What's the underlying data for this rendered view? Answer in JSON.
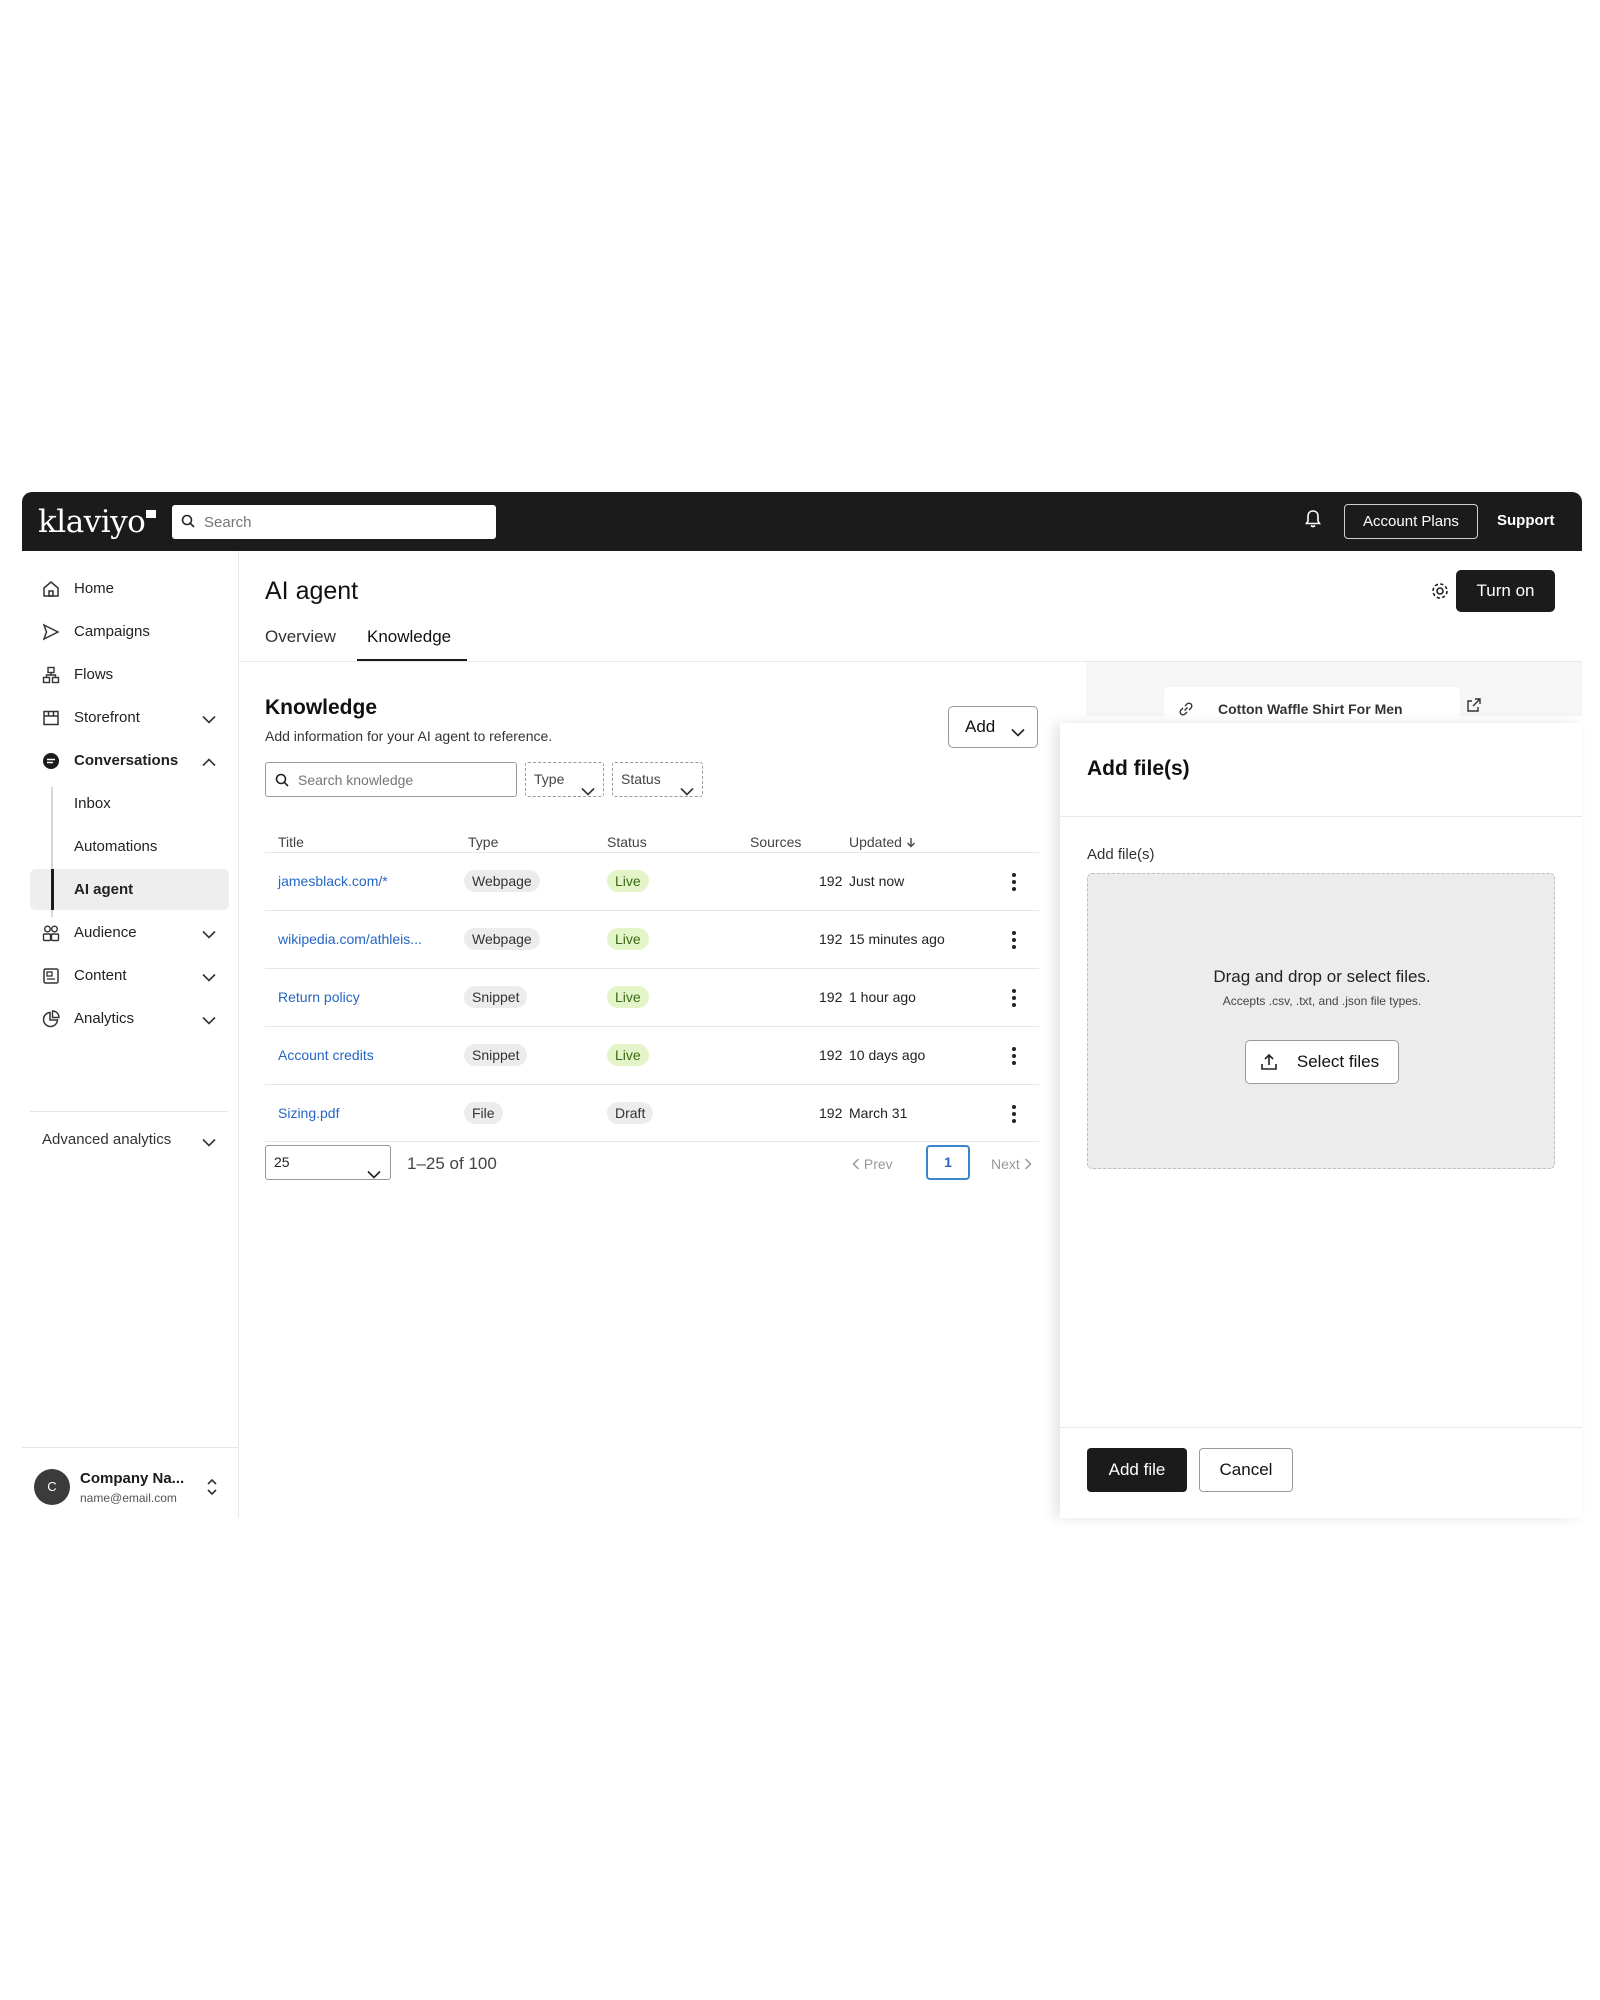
{
  "brand": {
    "logo_text": "klaviyo"
  },
  "topbar": {
    "search_placeholder": "Search",
    "account_plans_label": "Account Plans",
    "support_label": "Support"
  },
  "sidebar": {
    "items": [
      {
        "label": "Home",
        "icon": "home-icon"
      },
      {
        "label": "Campaigns",
        "icon": "send-icon"
      },
      {
        "label": "Flows",
        "icon": "flows-icon"
      },
      {
        "label": "Storefront",
        "icon": "storefront-icon"
      },
      {
        "label": "Conversations",
        "icon": "chat-icon"
      },
      {
        "label": "Audience",
        "icon": "audience-icon"
      },
      {
        "label": "Content",
        "icon": "content-icon"
      },
      {
        "label": "Analytics",
        "icon": "analytics-icon"
      }
    ],
    "sub_items": [
      "Inbox",
      "Automations",
      "AI agent"
    ],
    "advanced_label": "Advanced analytics",
    "account": {
      "initial": "C",
      "name": "Company Na...",
      "email": "name@email.com"
    }
  },
  "main": {
    "title": "AI agent",
    "turn_on_label": "Turn on",
    "tabs": [
      {
        "label": "Overview",
        "active": false
      },
      {
        "label": "Knowledge",
        "active": true
      }
    ],
    "knowledge": {
      "title": "Knowledge",
      "subtitle": "Add information for your AI agent to reference.",
      "add_label": "Add",
      "search_placeholder": "Search knowledge",
      "filters": [
        "Type",
        "Status"
      ],
      "columns": [
        "Title",
        "Type",
        "Status",
        "Sources",
        "Updated"
      ],
      "rows": [
        {
          "title": "jamesblack.com/*",
          "type": "Webpage",
          "status": "Live",
          "sources": "192",
          "updated": "Just now"
        },
        {
          "title": "wikipedia.com/athleis...",
          "type": "Webpage",
          "status": "Live",
          "sources": "192",
          "updated": "15 minutes ago"
        },
        {
          "title": "Return policy",
          "type": "Snippet",
          "status": "Live",
          "sources": "192",
          "updated": "1 hour ago"
        },
        {
          "title": "Account credits",
          "type": "Snippet",
          "status": "Live",
          "sources": "192",
          "updated": "10 days ago"
        },
        {
          "title": "Sizing.pdf",
          "type": "File",
          "status": "Draft",
          "sources": "192",
          "updated": "March 31"
        }
      ],
      "pagination": {
        "per_page": "25",
        "range": "1–25 of 100",
        "prev": "Prev",
        "page": "1",
        "next": "Next"
      }
    },
    "preview": {
      "product_title": "Cotton Waffle Shirt For Men"
    }
  },
  "drawer": {
    "title": "Add file(s)",
    "field_label": "Add file(s)",
    "dropzone_main": "Drag and drop or select files.",
    "dropzone_sub": "Accepts .csv, .txt, and .json file types.",
    "select_label": "Select files",
    "add_file_label": "Add file",
    "cancel_label": "Cancel"
  },
  "colors": {
    "topbar": "#1b1b1b",
    "link": "#2566c4",
    "live_pill_bg": "#e3f4c9",
    "pagination_active": "#3a86c8"
  }
}
